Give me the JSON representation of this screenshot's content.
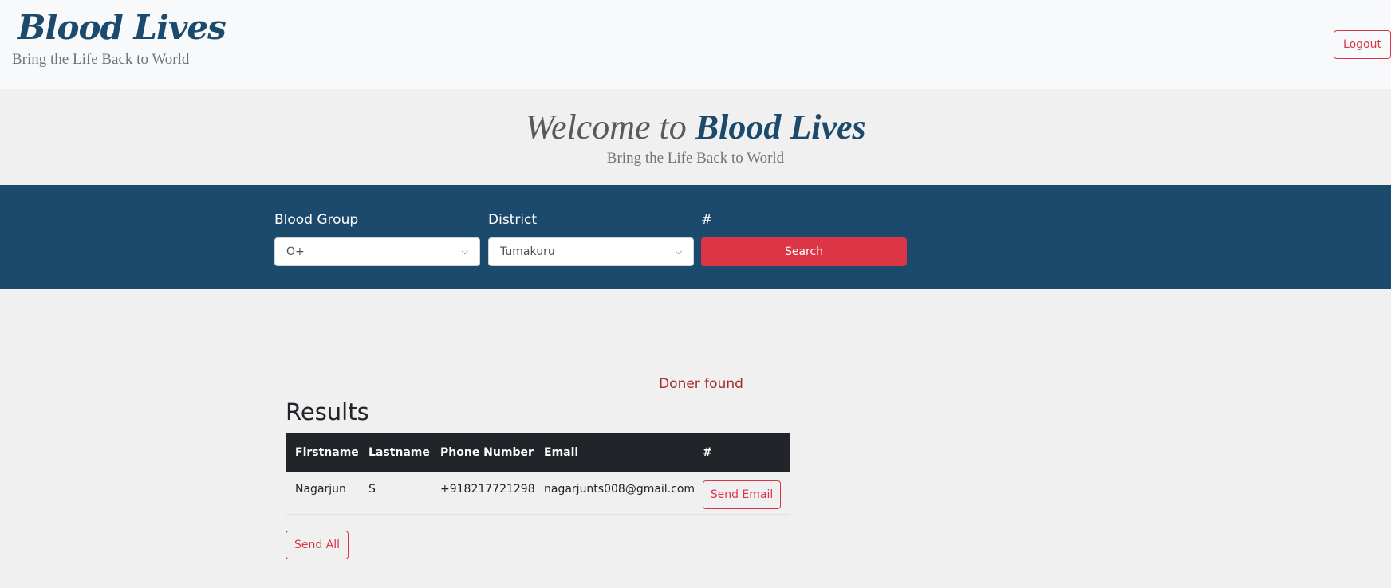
{
  "navbar": {
    "brand_title": "Blood Lives",
    "tagline": "Bring the Life Back to World",
    "logout_label": "Logout"
  },
  "hero": {
    "welcome_prefix": "Welcome to",
    "brand": "Blood Lives",
    "subtitle": "Bring the Life Back to World"
  },
  "search": {
    "blood_group_label": "Blood Group",
    "blood_group_value": "O+",
    "district_label": "District",
    "district_value": "Tumakuru",
    "action_label": "#",
    "search_button": "Search"
  },
  "results": {
    "status_message": "Doner found",
    "title": "Results",
    "columns": [
      "Firstname",
      "Lastname",
      "Phone Number",
      "Email",
      "#"
    ],
    "rows": [
      {
        "firstname": "Nagarjun",
        "lastname": "S",
        "phone": "+918217721298",
        "email": "nagarjunts008@gmail.com",
        "action": "Send Email"
      }
    ],
    "send_all_label": "Send All"
  },
  "colors": {
    "brand_blue": "#1c4a6c",
    "accent_red": "#dc3545",
    "status_red": "#a52a2a",
    "table_header": "#212529"
  },
  "icons": {
    "select_chevron": "chevron-down-icon"
  }
}
